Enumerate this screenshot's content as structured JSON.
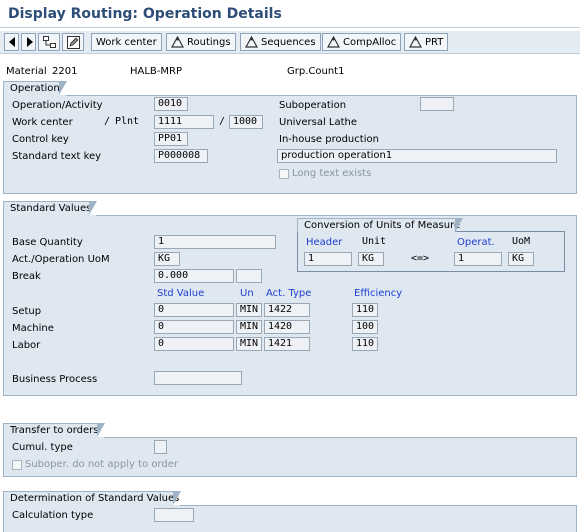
{
  "title": "Display Routing: Operation Details",
  "toolbar": {
    "buttons": [
      {
        "label": "Work center",
        "icon": "work-center-icon"
      },
      {
        "label": "Routings",
        "icon": "routing-icon"
      },
      {
        "label": "Sequences",
        "icon": "routing-icon"
      },
      {
        "label": "CompAlloc",
        "icon": "routing-icon"
      },
      {
        "label": "PRT",
        "icon": "routing-icon"
      }
    ]
  },
  "header": {
    "material_label": "Material",
    "material": "2201",
    "routing": "HALB-MRP",
    "grp_count": "Grp.Count1"
  },
  "operation": {
    "tab": "Operation",
    "op_activity_label": "Operation/Activity",
    "op_activity": "0010",
    "work_center_label": "Work center",
    "plnt_label": "Plnt",
    "work_center": "1111",
    "plant": "1000",
    "control_key_label": "Control key",
    "control_key": "PP01",
    "std_text_key_label": "Standard text key",
    "std_text_key": "P000008",
    "suboperation_label": "Suboperation",
    "suboperation": "",
    "work_center_desc": "Universal Lathe",
    "control_key_desc": "In-house production",
    "short_text": "production operation1",
    "long_text_label": "Long text exists"
  },
  "standard_values": {
    "tab": "Standard Values",
    "base_qty_label": "Base Quantity",
    "base_qty": "1",
    "uom_label": "Act./Operation UoM",
    "uom": "KG",
    "break_label": "Break",
    "break": "0.000",
    "col_std_value": "Std Value",
    "col_un": "Un",
    "col_act_type": "Act. Type",
    "col_efficiency": "Efficiency",
    "rows": [
      {
        "label": "Setup",
        "value": "0",
        "unit": "MIN",
        "act_type": "1422",
        "eff": "110"
      },
      {
        "label": "Machine",
        "value": "0",
        "unit": "MIN",
        "act_type": "1420",
        "eff": "100"
      },
      {
        "label": "Labor",
        "value": "0",
        "unit": "MIN",
        "act_type": "1421",
        "eff": "110"
      }
    ],
    "business_process_label": "Business Process",
    "business_process": "",
    "conversion": {
      "tab": "Conversion of Units of Measure",
      "header_label": "Header",
      "unit_label": "Unit",
      "operat_label": "Operat.",
      "uom_label": "UoM",
      "header_qty": "1",
      "header_unit": "KG",
      "arrow": "<=>",
      "op_qty": "1",
      "op_unit": "KG"
    }
  },
  "transfer": {
    "tab": "Transfer to orders",
    "cumul_label": "Cumul. type",
    "suboper_label": "Suboper. do not apply to order"
  },
  "determination": {
    "tab": "Determination of Standard Values",
    "calc_type_label": "Calculation type"
  }
}
